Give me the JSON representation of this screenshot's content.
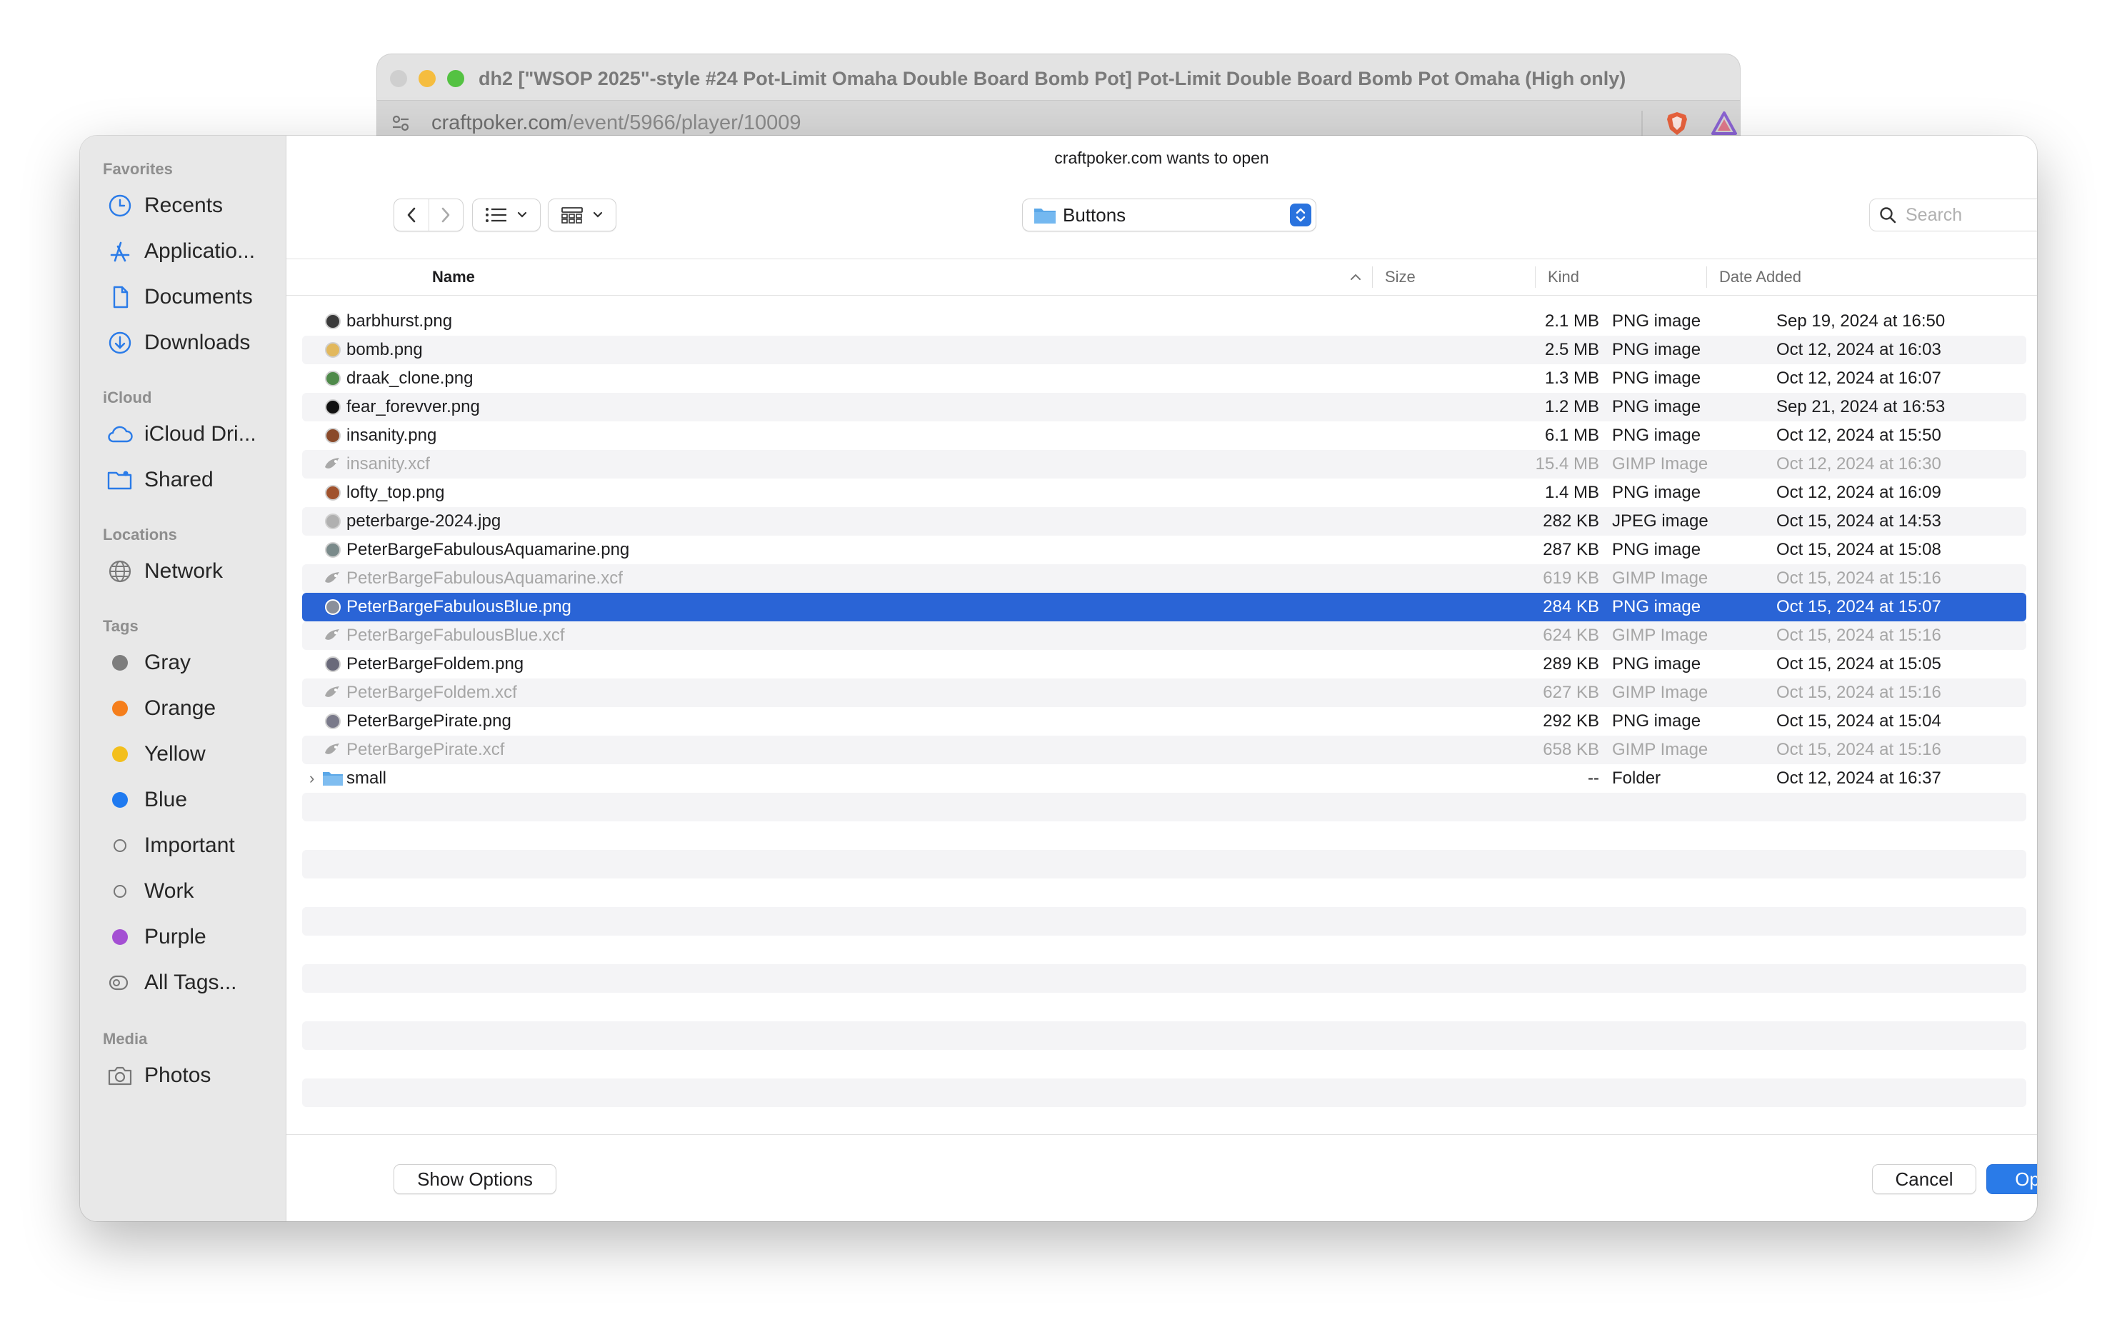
{
  "browser": {
    "title": "dh2 [\"WSOP 2025\"-style #24 Pot-Limit Omaha Double Board Bomb Pot] Pot-Limit Double Board Bomb Pot Omaha (High only)",
    "url_host": "craftpoker.com",
    "url_path": "/event/5966/player/10009"
  },
  "dialog": {
    "prompt": "craftpoker.com wants to open",
    "location": "Buttons",
    "search_placeholder": "Search",
    "show_options_label": "Show Options",
    "cancel_label": "Cancel",
    "open_label": "Open"
  },
  "sidebar": {
    "favorites_heading": "Favorites",
    "favorites": [
      {
        "label": "Recents",
        "icon": "clock-icon"
      },
      {
        "label": "Applicatio...",
        "icon": "applications-icon"
      },
      {
        "label": "Documents",
        "icon": "document-icon"
      },
      {
        "label": "Downloads",
        "icon": "download-icon"
      }
    ],
    "icloud_heading": "iCloud",
    "icloud": [
      {
        "label": "iCloud Dri...",
        "icon": "cloud-icon"
      },
      {
        "label": "Shared",
        "icon": "shared-folder-icon"
      }
    ],
    "locations_heading": "Locations",
    "locations": [
      {
        "label": "Network",
        "icon": "globe-icon"
      }
    ],
    "tags_heading": "Tags",
    "tags": [
      {
        "label": "Gray",
        "color": "#7d7d7d"
      },
      {
        "label": "Orange",
        "color": "#f57e1b"
      },
      {
        "label": "Yellow",
        "color": "#f3bf1c"
      },
      {
        "label": "Blue",
        "color": "#1f7af0"
      },
      {
        "label": "Important",
        "color": ""
      },
      {
        "label": "Work",
        "color": ""
      },
      {
        "label": "Purple",
        "color": "#a44fd3"
      },
      {
        "label": "All Tags...",
        "color": ""
      }
    ],
    "media_heading": "Media",
    "media": [
      {
        "label": "Photos",
        "icon": "camera-icon"
      }
    ]
  },
  "columns": {
    "name": "Name",
    "size": "Size",
    "kind": "Kind",
    "date": "Date Added"
  },
  "files": [
    {
      "name": "barbhurst.png",
      "size": "2.1 MB",
      "kind": "PNG image",
      "date": "Sep 19, 2024 at 16:50",
      "dim": false,
      "icon_color": "#3a3a3a"
    },
    {
      "name": "bomb.png",
      "size": "2.5 MB",
      "kind": "PNG image",
      "date": "Oct 12, 2024 at 16:03",
      "dim": false,
      "icon_color": "#e2b85c"
    },
    {
      "name": "draak_clone.png",
      "size": "1.3 MB",
      "kind": "PNG image",
      "date": "Oct 12, 2024 at 16:07",
      "dim": false,
      "icon_color": "#4f8a4a"
    },
    {
      "name": "fear_forevver.png",
      "size": "1.2 MB",
      "kind": "PNG image",
      "date": "Sep 21, 2024 at 16:53",
      "dim": false,
      "icon_color": "#111111"
    },
    {
      "name": "insanity.png",
      "size": "6.1 MB",
      "kind": "PNG image",
      "date": "Oct 12, 2024 at 15:50",
      "dim": false,
      "icon_color": "#8a4a2a"
    },
    {
      "name": "insanity.xcf",
      "size": "15.4 MB",
      "kind": "GIMP Image",
      "date": "Oct 12, 2024 at 16:30",
      "dim": true,
      "icon_color": "#9a9a9a"
    },
    {
      "name": "lofty_top.png",
      "size": "1.4 MB",
      "kind": "PNG image",
      "date": "Oct 12, 2024 at 16:09",
      "dim": false,
      "icon_color": "#a0522d"
    },
    {
      "name": "peterbarge-2024.jpg",
      "size": "282 KB",
      "kind": "JPEG image",
      "date": "Oct 15, 2024 at 14:53",
      "dim": false,
      "icon_color": "#b0b0b0"
    },
    {
      "name": "PeterBargeFabulousAquamarine.png",
      "size": "287 KB",
      "kind": "PNG image",
      "date": "Oct 15, 2024 at 15:08",
      "dim": false,
      "icon_color": "#7a8a8a"
    },
    {
      "name": "PeterBargeFabulousAquamarine.xcf",
      "size": "619 KB",
      "kind": "GIMP Image",
      "date": "Oct 15, 2024 at 15:16",
      "dim": true,
      "icon_color": "#9a9a9a"
    },
    {
      "name": "PeterBargeFabulousBlue.png",
      "size": "284 KB",
      "kind": "PNG image",
      "date": "Oct 15, 2024 at 15:07",
      "dim": false,
      "selected": true,
      "icon_color": "#8a8f9a"
    },
    {
      "name": "PeterBargeFabulousBlue.xcf",
      "size": "624 KB",
      "kind": "GIMP Image",
      "date": "Oct 15, 2024 at 15:16",
      "dim": true,
      "icon_color": "#9a9a9a"
    },
    {
      "name": "PeterBargeFoldem.png",
      "size": "289 KB",
      "kind": "PNG image",
      "date": "Oct 15, 2024 at 15:05",
      "dim": false,
      "icon_color": "#6a6a7a"
    },
    {
      "name": "PeterBargeFoldem.xcf",
      "size": "627 KB",
      "kind": "GIMP Image",
      "date": "Oct 15, 2024 at 15:16",
      "dim": true,
      "icon_color": "#9a9a9a"
    },
    {
      "name": "PeterBargePirate.png",
      "size": "292 KB",
      "kind": "PNG image",
      "date": "Oct 15, 2024 at 15:04",
      "dim": false,
      "icon_color": "#7a7a8a"
    },
    {
      "name": "PeterBargePirate.xcf",
      "size": "658 KB",
      "kind": "GIMP Image",
      "date": "Oct 15, 2024 at 15:16",
      "dim": true,
      "icon_color": "#9a9a9a"
    },
    {
      "name": "small",
      "size": "--",
      "kind": "Folder",
      "date": "Oct 12, 2024 at 16:37",
      "dim": false,
      "folder": true,
      "icon_color": "#5aa7e8"
    }
  ]
}
